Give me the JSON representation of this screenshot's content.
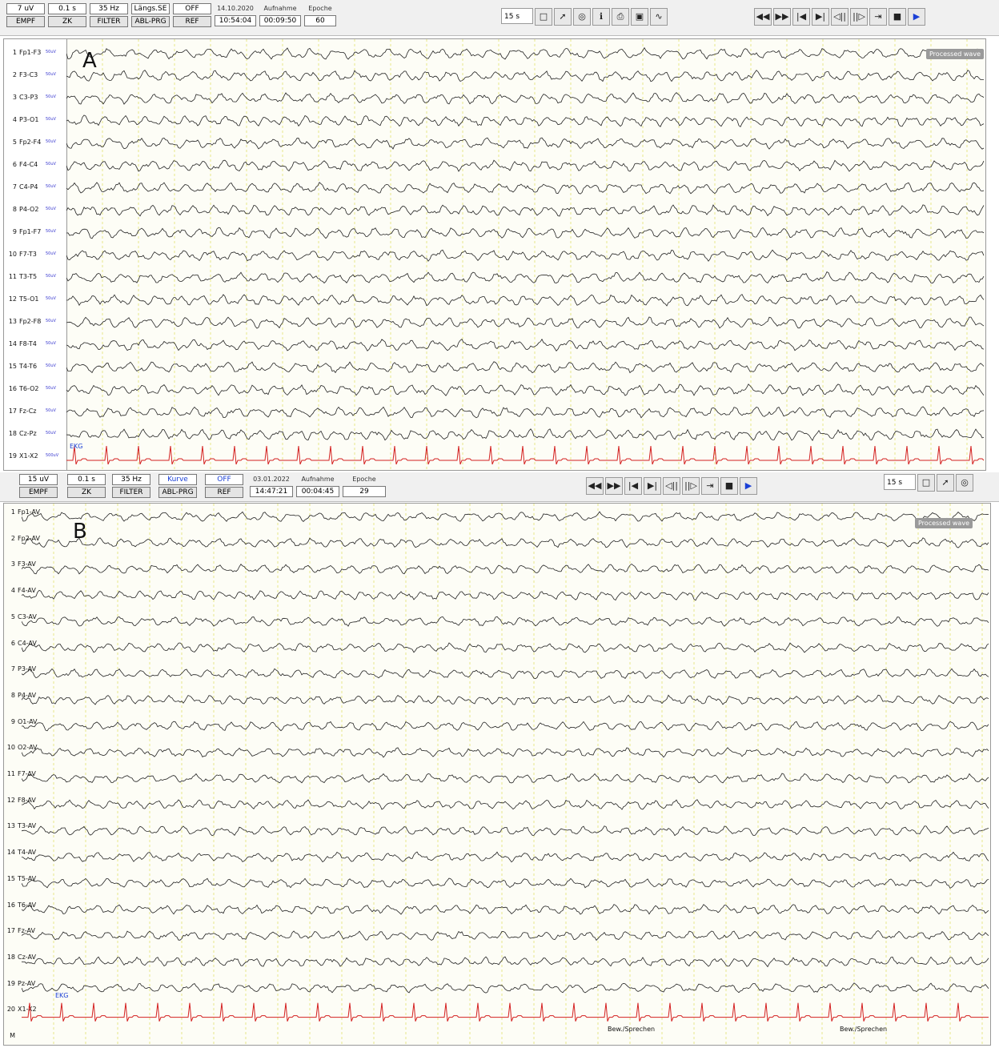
{
  "panelA": {
    "letter": "A",
    "toolbar": {
      "cells": [
        {
          "value": "7 uV",
          "label": "EMPF"
        },
        {
          "value": "0.1 s",
          "label": "ZK"
        },
        {
          "value": "35 Hz",
          "label": "FILTER"
        },
        {
          "value": "Längs.SE",
          "label": "ABL-PRG"
        },
        {
          "value": "OFF",
          "label": "REF"
        }
      ],
      "date": "14.10.2020",
      "time": "10:54:04",
      "aufnahme_label": "Aufnahme",
      "aufnahme_value": "00:09:50",
      "epoche_label": "Epoche",
      "epoche_value": "60",
      "timebase": "15 s"
    },
    "scale_label": "50uV",
    "processed_label": "Processed wave",
    "ekg_label": "EKG",
    "channels": [
      {
        "num": "1",
        "name": "Fp1-F3"
      },
      {
        "num": "2",
        "name": "F3-C3"
      },
      {
        "num": "3",
        "name": "C3-P3"
      },
      {
        "num": "4",
        "name": "P3-O1"
      },
      {
        "num": "5",
        "name": "Fp2-F4"
      },
      {
        "num": "6",
        "name": "F4-C4"
      },
      {
        "num": "7",
        "name": "C4-P4"
      },
      {
        "num": "8",
        "name": "P4-O2"
      },
      {
        "num": "9",
        "name": "Fp1-F7"
      },
      {
        "num": "10",
        "name": "F7-T3"
      },
      {
        "num": "11",
        "name": "T3-T5"
      },
      {
        "num": "12",
        "name": "T5-O1"
      },
      {
        "num": "13",
        "name": "Fp2-F8"
      },
      {
        "num": "14",
        "name": "F8-T4"
      },
      {
        "num": "15",
        "name": "T4-T6"
      },
      {
        "num": "16",
        "name": "T6-O2"
      },
      {
        "num": "17",
        "name": "Fz-Cz"
      },
      {
        "num": "18",
        "name": "Cz-Pz"
      },
      {
        "num": "19",
        "name": "X1-X2",
        "scale": "500uV"
      }
    ]
  },
  "panelB": {
    "letter": "B",
    "toolbar": {
      "cells": [
        {
          "value": "15 uV",
          "label": "EMPF"
        },
        {
          "value": "0.1 s",
          "label": "ZK"
        },
        {
          "value": "35 Hz",
          "label": "FILTER"
        },
        {
          "value": "Kurve",
          "label": "ABL-PRG"
        },
        {
          "value": "OFF",
          "label": "REF"
        }
      ],
      "date": "03.01.2022",
      "time": "14:47:21",
      "aufnahme_label": "Aufnahme",
      "aufnahme_value": "00:04:45",
      "epoche_label": "Epoche",
      "epoche_value": "29",
      "timebase": "15 s"
    },
    "processed_label": "Processed wave",
    "ekg_label": "EKG",
    "marker_label": "Bew./Sprechen",
    "channels": [
      {
        "num": "1",
        "name": "Fp1-AV"
      },
      {
        "num": "2",
        "name": "Fp2-AV"
      },
      {
        "num": "3",
        "name": "F3-AV"
      },
      {
        "num": "4",
        "name": "F4-AV"
      },
      {
        "num": "5",
        "name": "C3-AV"
      },
      {
        "num": "6",
        "name": "C4-AV"
      },
      {
        "num": "7",
        "name": "P3-AV"
      },
      {
        "num": "8",
        "name": "P4-AV"
      },
      {
        "num": "9",
        "name": "O1-AV"
      },
      {
        "num": "10",
        "name": "O2-AV"
      },
      {
        "num": "11",
        "name": "F7-AV"
      },
      {
        "num": "12",
        "name": "F8-AV"
      },
      {
        "num": "13",
        "name": "T3-AV"
      },
      {
        "num": "14",
        "name": "T4-AV"
      },
      {
        "num": "15",
        "name": "T5-AV"
      },
      {
        "num": "16",
        "name": "T6-AV"
      },
      {
        "num": "17",
        "name": "Fz-AV"
      },
      {
        "num": "18",
        "name": "Cz-AV"
      },
      {
        "num": "19",
        "name": "Pz-AV"
      },
      {
        "num": "20",
        "name": "X1-X2"
      },
      {
        "num": "M",
        "name": ""
      }
    ]
  },
  "icons": {
    "tools": [
      "save-icon",
      "montage-icon",
      "globe-icon",
      "info-icon",
      "print-icon",
      "camera-icon",
      "wave-icon"
    ],
    "nav": [
      "rewind-icon",
      "fast-forward-icon",
      "skip-start-icon",
      "skip-end-icon",
      "step-back-icon",
      "step-forward-icon",
      "collapse-icon",
      "stop-icon",
      "play-icon"
    ]
  },
  "colors": {
    "trace": "#222222",
    "ekg": "#d42020",
    "grid": "#e6e68a",
    "accent": "#1a3fd6"
  }
}
